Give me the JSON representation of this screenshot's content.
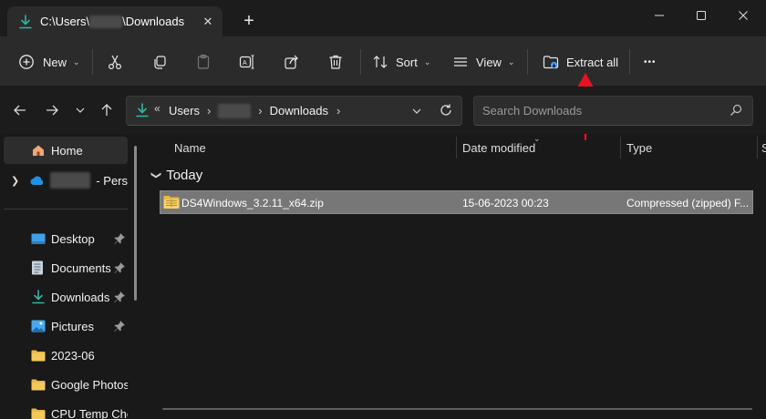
{
  "tab": {
    "path_prefix": "C:\\Users\\",
    "path_suffix": "\\Downloads",
    "close_glyph": "✕",
    "new_tab_glyph": "+"
  },
  "window_controls": {
    "minimize": "minimize-icon",
    "maximize": "maximize-icon",
    "close": "close-icon"
  },
  "toolbar": {
    "new_label": "New",
    "sort_label": "Sort",
    "view_label": "View",
    "extract_label": "Extract all",
    "more_glyph": "•••",
    "icons": [
      "cut-icon",
      "copy-icon",
      "paste-icon",
      "rename-icon",
      "share-icon",
      "delete-icon"
    ]
  },
  "address": {
    "chevrons": "«",
    "items": [
      "Users",
      "Downloads"
    ],
    "separator": "›"
  },
  "search": {
    "placeholder": "Search Downloads"
  },
  "sidebar": {
    "home": "Home",
    "onedrive_suffix": "- Pers",
    "items": [
      {
        "label": "Desktop",
        "icon": "desktop-icon",
        "pinned": true
      },
      {
        "label": "Documents",
        "icon": "documents-icon",
        "pinned": true
      },
      {
        "label": "Downloads",
        "icon": "downloads-icon",
        "pinned": true
      },
      {
        "label": "Pictures",
        "icon": "pictures-icon",
        "pinned": true
      },
      {
        "label": "2023-06",
        "icon": "folder-icon",
        "pinned": false
      },
      {
        "label": "Google Photos e",
        "icon": "folder-icon",
        "pinned": false
      },
      {
        "label": "CPU Temp Chec",
        "icon": "folder-icon",
        "pinned": false
      }
    ]
  },
  "columns": {
    "name": "Name",
    "date": "Date modified",
    "type": "Type",
    "size": "S"
  },
  "group": {
    "label": "Today"
  },
  "files": [
    {
      "name": "DS4Windows_3.2.11_x64.zip",
      "date": "15-06-2023 00:23",
      "type": "Compressed (zipped) F..."
    }
  ],
  "colors": {
    "accent_red": "#e81123",
    "download_green": "#2fb6a0",
    "folder_yellow": "#e8b94a",
    "selection": "#777777"
  }
}
